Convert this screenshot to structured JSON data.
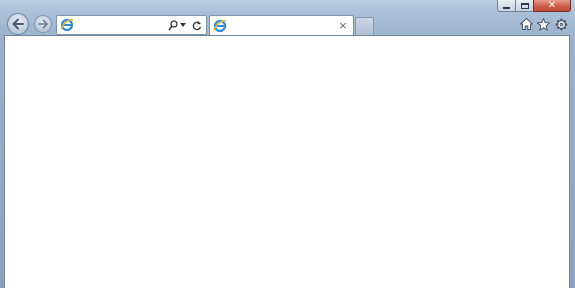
{
  "window": {
    "caption_buttons": [
      "minimize",
      "maximize",
      "close"
    ]
  },
  "navigation": {
    "back_icon": "back-arrow-icon",
    "forward_icon": "forward-arrow-icon"
  },
  "address_bar": {
    "value": "",
    "placeholder": "",
    "site_icon": "ie-logo-icon",
    "tools": [
      "search-icon",
      "dropdown-arrow-icon",
      "refresh-icon"
    ]
  },
  "tabs": [
    {
      "title": "",
      "icon": "ie-logo-icon",
      "close": "×"
    }
  ],
  "command_bar": {
    "icons": [
      "home-icon",
      "favorites-star-icon",
      "tools-gear-icon"
    ]
  },
  "colors": {
    "frame": "#9fb4cc",
    "close_button": "#c75a46",
    "content": "#ffffff"
  }
}
